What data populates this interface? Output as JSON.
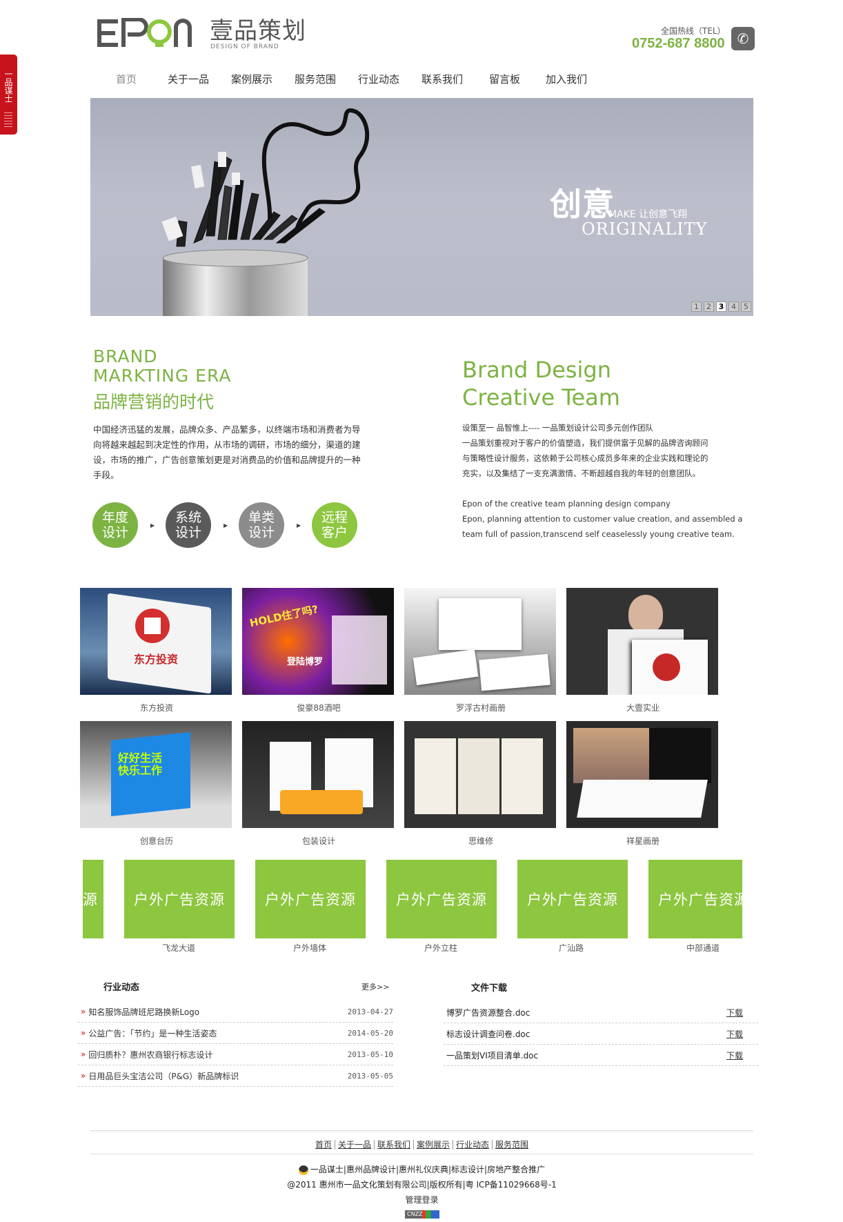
{
  "side_tab": {
    "label": "一品谋士"
  },
  "header": {
    "logo_en": "EPON",
    "logo_cn": "壹品策划",
    "logo_sub": "DESIGN OF BRAND",
    "hotline_label": "全国热线（TEL）",
    "hotline_number": "0752-687 8800",
    "phone_icon": "phone-icon"
  },
  "nav": {
    "items": [
      {
        "label": "首页",
        "active": true
      },
      {
        "label": "关于一品"
      },
      {
        "label": "案例展示"
      },
      {
        "label": "服务范围"
      },
      {
        "label": "行业动态"
      },
      {
        "label": "联系我们"
      },
      {
        "label": "留言板"
      },
      {
        "label": "加入我们"
      }
    ]
  },
  "banner": {
    "cn": "创意",
    "make": "MAKE 让创意飞翔",
    "originality": "ORIGINALITY",
    "pages": [
      "1",
      "2",
      "3",
      "4",
      "5"
    ],
    "current_page": "3"
  },
  "intro_left": {
    "en1": "BRAND",
    "en2": "MARKTING ERA",
    "cn": "品牌营销的时代",
    "text": "中国经济迅猛的发展，品牌众多、产品繁多，以终端市场和消费者为导向将越来越起到决定性的作用，从市场的调研，市场的细分，渠道的建设，市场的推广，广告创意策划更是对消费品的价值和品牌提升的一种手段。",
    "circles": [
      {
        "line1": "年度",
        "line2": "设计",
        "color": "#7cb342"
      },
      {
        "line1": "系统",
        "line2": "设计",
        "color": "#5a5a5a"
      },
      {
        "line1": "单类",
        "line2": "设计",
        "color": "#8c8c8c"
      },
      {
        "line1": "远程",
        "line2": "客户",
        "color": "#8dc63f"
      }
    ]
  },
  "intro_right": {
    "title1": "Brand Design",
    "title2": "Creative Team",
    "cn_lines": [
      "设策至一 品智惟上----  一品策划设计公司多元创作团队",
      "一品策划重视对于客户的价值塑造，我们提供富于见解的品牌咨询顾问",
      "与策略性设计服务，这依赖于公司核心成员多年来的企业实践和理论的",
      "充实，以及集结了一支充满激情、不断超越自我的年轻的创意团队。"
    ],
    "en_lines": [
      "Epon of the creative team planning design company",
      "Epon, planning attention to customer value creation, and assembled a",
      "team full of passion,transcend self ceaselessly young creative team."
    ]
  },
  "portfolio": [
    {
      "caption": "东方投资"
    },
    {
      "caption": "俊豪88酒吧"
    },
    {
      "caption": "罗浮古村画册"
    },
    {
      "caption": "大壹实业"
    },
    {
      "caption": "创意台历"
    },
    {
      "caption": "包装设计"
    },
    {
      "caption": "思维修"
    },
    {
      "caption": "祥星画册"
    }
  ],
  "portfolio_img_text": {
    "p1": "东方投资",
    "p2": "HOLD住了吗?",
    "p2b": "登陆博罗",
    "p5": "好好生活 快乐工作"
  },
  "outdoor": {
    "tile_label": "户外广告资源",
    "partial_left": "源",
    "partial_right": "户外广告资源",
    "captions": [
      "飞龙大道",
      "户外墙体",
      "户外立柱",
      "广汕路",
      "中部通道"
    ]
  },
  "news": {
    "title": "行业动态",
    "more": "更多>>",
    "items": [
      {
        "title": "知名服饰品牌班尼路换新Logo",
        "date": "2013-04-27"
      },
      {
        "title": "公益广告：「节约」是一种生活姿态",
        "date": "2014-05-20"
      },
      {
        "title": "回归质朴？惠州农商银行标志设计",
        "date": "2013-05-10"
      },
      {
        "title": "日用品巨头宝洁公司（P&G）新品牌标识",
        "date": "2013-05-05"
      }
    ]
  },
  "files": {
    "title": "文件下载",
    "download_label": "下载",
    "items": [
      {
        "name": "博罗广告资源整合.doc"
      },
      {
        "name": "标志设计调查问卷.doc"
      },
      {
        "name": "一品策划VI项目清单.doc"
      }
    ]
  },
  "footer": {
    "nav": [
      "首页",
      "关于一品",
      "联系我们",
      "案例展示",
      "行业动态",
      "服务范围"
    ],
    "links": "一品谋士|惠州品牌设计|惠州礼仪庆典|标志设计|房地产整合推广",
    "copyright": "@2011 惠州市一品文化策划有限公司|版权所有|粤 ICP备11029668号-1",
    "admin": "管理登录",
    "cnzz": "CNZZ"
  }
}
